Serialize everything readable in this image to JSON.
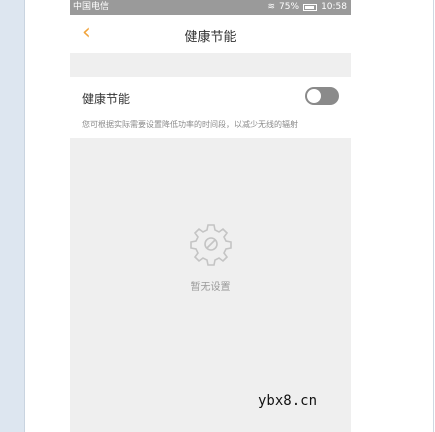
{
  "statusbar": {
    "carrier": "中国电信",
    "battery": "75%",
    "time": "10:58"
  },
  "navbar": {
    "back_icon": "chevron-left-icon",
    "title": "健康节能"
  },
  "setting": {
    "label": "健康节能",
    "toggle_on": false,
    "description": "您可根据实际需要设置降低功率的时间段，以减少无线的辐射"
  },
  "empty_state": {
    "icon": "gear-icon",
    "label": "暂无设置"
  },
  "watermark": "ybx8.cn",
  "colors": {
    "accent": "#f1a33a",
    "statusbar": "#9a9a9a",
    "toggle_off": "#8a8a8a"
  }
}
